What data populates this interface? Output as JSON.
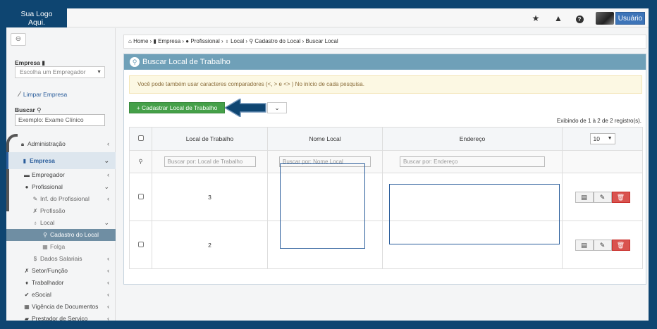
{
  "header": {
    "logo_line1": "Sua Logo",
    "logo_line2": "Aqui.",
    "user_label": "Usuário"
  },
  "sidebar": {
    "empresa_label": "Empresa",
    "empresa_placeholder": "Escolha um Empregador",
    "limpar": "Limpar Empresa",
    "buscar_label": "Buscar",
    "buscar_value": "Exemplo: Exame Clínico",
    "menu": [
      {
        "label": "Administração",
        "icon": "lock-icon"
      },
      {
        "label": "Empresa",
        "icon": "building-icon"
      },
      {
        "label": "Empregador",
        "icon": "briefcase-icon"
      },
      {
        "label": "Profissional",
        "icon": "user-icon"
      },
      {
        "label": "Inf. do Profissional",
        "icon": "pencil-icon"
      },
      {
        "label": "Profissão",
        "icon": "wrench-icon"
      },
      {
        "label": "Local",
        "icon": "map-marker-icon"
      },
      {
        "label": "Cadastro do Local",
        "icon": "search-icon"
      },
      {
        "label": "Folga",
        "icon": "calendar-icon"
      },
      {
        "label": "Dados Salariais",
        "icon": "dollar-icon"
      },
      {
        "label": "Setor/Função",
        "icon": "tools-icon"
      },
      {
        "label": "Trabalhador",
        "icon": "male-icon"
      },
      {
        "label": "eSocial",
        "icon": "check-icon"
      },
      {
        "label": "Vigência de Documentos",
        "icon": "calendar-icon"
      },
      {
        "label": "Prestador de Serviço",
        "icon": "car-icon"
      }
    ]
  },
  "breadcrumb": [
    "Home",
    "Empresa",
    "Profissional",
    "Local",
    "Cadastro do Local",
    "Buscar Local"
  ],
  "panel": {
    "title": "Buscar Local de Trabalho",
    "alert": "Você pode também usar caracteres comparadores (<, > e <> ) No início de cada pesquisa.",
    "add_button": "Cadastrar Local de Trabalho",
    "showing": "Exibindo de 1 à 2 de 2 registro(s).",
    "page_length": "10"
  },
  "table": {
    "headers": [
      "Local de Trabalho",
      "Nome Local",
      "Endereço"
    ],
    "filters": [
      "Buscar por: Local de Trabalho",
      "Buscar por: Nome Local",
      "Buscar por: Endereço"
    ],
    "rows": [
      {
        "local": "3"
      },
      {
        "local": "2"
      }
    ]
  }
}
